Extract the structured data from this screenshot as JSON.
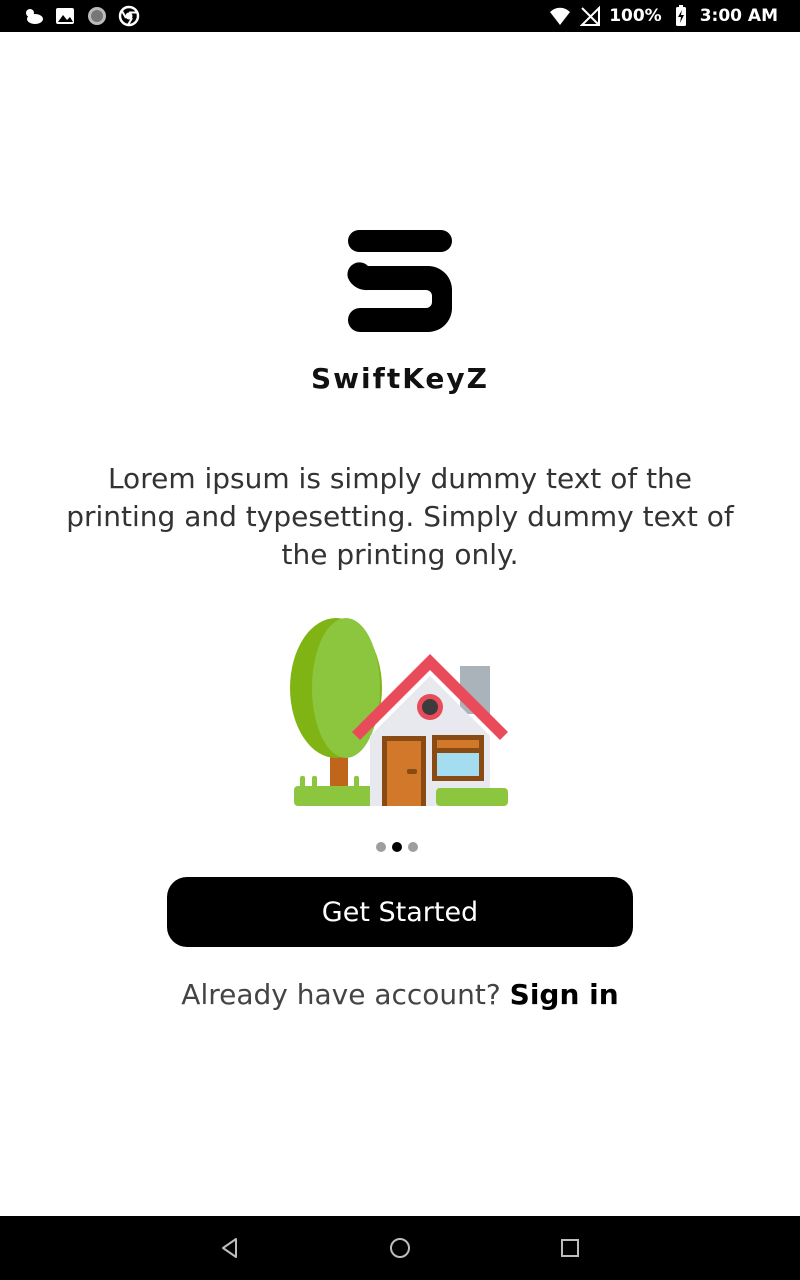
{
  "status_bar": {
    "battery": "100%",
    "time": "3:00 AM",
    "left_icons": [
      "weather-icon",
      "image-icon",
      "circle-icon",
      "chrome-icon"
    ],
    "right_icons": [
      "wifi-icon",
      "no-signal-icon",
      "battery-charging-icon"
    ]
  },
  "app": {
    "name": "SwiftKeyZ",
    "logo_icon": "swiftkeyz-s-logo"
  },
  "onboarding": {
    "description": "Lorem ipsum is simply dummy text of the printing and typesetting. Simply dummy text of the printing only.",
    "illustration": "house-with-tree",
    "page_indicator": {
      "count": 3,
      "active_index": 1
    }
  },
  "actions": {
    "get_started_label": "Get Started",
    "signin_prompt": "Already have account? ",
    "signin_label": "Sign in"
  },
  "navigation": {
    "buttons": [
      "back-icon",
      "home-icon",
      "recents-icon"
    ]
  },
  "colors": {
    "primary": "#000000",
    "background": "#ffffff",
    "roof": "#e94b5a",
    "tree": "#8cc63f",
    "door": "#d2782a"
  }
}
